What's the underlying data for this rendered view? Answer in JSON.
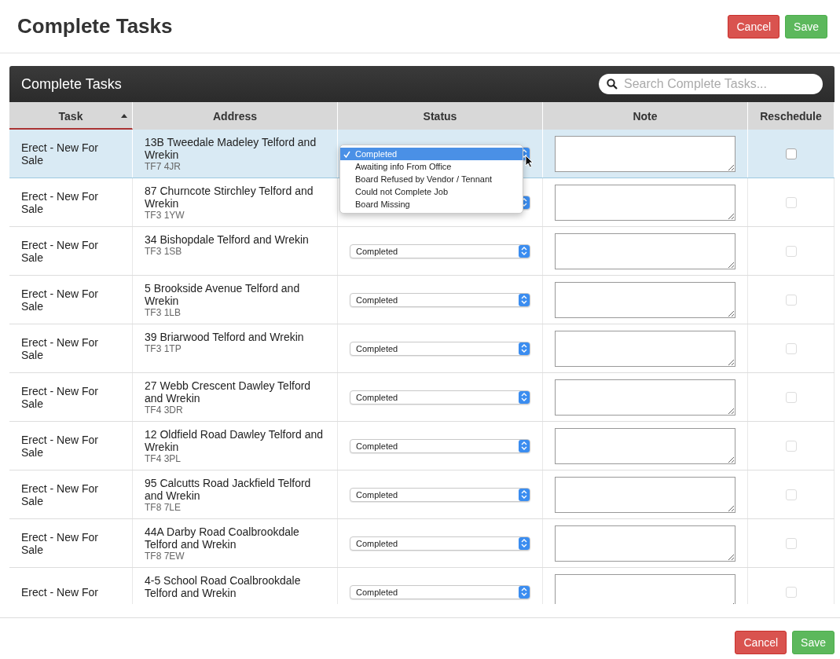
{
  "page": {
    "title": "Complete Tasks",
    "buttons": [
      {
        "label": "Cancel",
        "kind": "danger"
      },
      {
        "label": "Save",
        "kind": "success"
      }
    ]
  },
  "panel": {
    "title": "Complete Tasks",
    "search": {
      "placeholder": "Search Complete Tasks..."
    }
  },
  "table": {
    "columns": [
      {
        "label": "Task",
        "sorted": true
      },
      {
        "label": "Address",
        "sorted": false
      },
      {
        "label": "Status",
        "sorted": false
      },
      {
        "label": "Note",
        "sorted": false
      },
      {
        "label": "Reschedule",
        "sorted": false
      }
    ],
    "rows": [
      {
        "task": "Erect - New For Sale",
        "address": "13B Tweedale Madeley Telford and Wrekin",
        "postcode": "TF7 4JR",
        "status": "",
        "selected": true,
        "checked": false,
        "disabled": false,
        "status_menu": {
          "options": [
            {
              "label": "Completed",
              "selected": true
            },
            {
              "label": "Awaiting info From Office",
              "selected": false
            },
            {
              "label": "Board Refused by Vendor / Tennant",
              "selected": false
            },
            {
              "label": "Could not Complete Job",
              "selected": false
            },
            {
              "label": "Board Missing",
              "selected": false
            }
          ]
        }
      },
      {
        "task": "Erect - New For Sale",
        "address": "87 Churncote Stirchley Telford and Wrekin",
        "postcode": "TF3 1YW",
        "status": "",
        "selected": false,
        "checked": false,
        "disabled": true
      },
      {
        "task": "Erect - New For Sale",
        "address": "34 Bishopdale Telford and Wrekin",
        "postcode": "TF3 1SB",
        "status": "Completed",
        "selected": false,
        "checked": false,
        "disabled": true
      },
      {
        "task": "Erect - New For Sale",
        "address": "5 Brookside Avenue Telford and Wrekin",
        "postcode": "TF3 1LB",
        "status": "Completed",
        "selected": false,
        "checked": false,
        "disabled": true
      },
      {
        "task": "Erect - New For Sale",
        "address": "39 Briarwood Telford and Wrekin",
        "postcode": "TF3 1TP",
        "status": "Completed",
        "selected": false,
        "checked": false,
        "disabled": true
      },
      {
        "task": "Erect - New For Sale",
        "address": "27 Webb Crescent Dawley Telford and Wrekin",
        "postcode": "TF4 3DR",
        "status": "Completed",
        "selected": false,
        "checked": false,
        "disabled": true
      },
      {
        "task": "Erect - New For Sale",
        "address": "12 Oldfield Road Dawley Telford and Wrekin",
        "postcode": "TF4 3PL",
        "status": "Completed",
        "selected": false,
        "checked": false,
        "disabled": true
      },
      {
        "task": "Erect - New For Sale",
        "address": "95 Calcutts Road Jackfield Telford and Wrekin",
        "postcode": "TF8 7LE",
        "status": "Completed",
        "selected": false,
        "checked": false,
        "disabled": true
      },
      {
        "task": "Erect - New For Sale",
        "address": "44A Darby Road Coalbrookdale Telford and Wrekin",
        "postcode": "TF8 7EW",
        "status": "Completed",
        "selected": false,
        "checked": false,
        "disabled": true
      },
      {
        "task": "Erect - New For",
        "address": "4-5 School Road Coalbrookdale Telford and Wrekin",
        "postcode": "",
        "status": "Completed",
        "selected": false,
        "checked": false,
        "disabled": true
      }
    ]
  },
  "footer": {
    "buttons": [
      {
        "label": "Cancel",
        "kind": "danger"
      },
      {
        "label": "Save",
        "kind": "success"
      }
    ]
  }
}
